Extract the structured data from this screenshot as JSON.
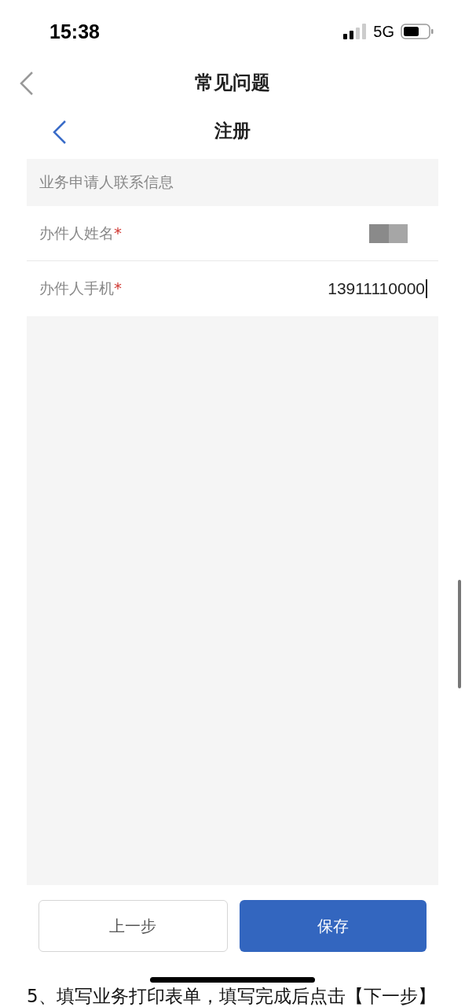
{
  "status_bar": {
    "time": "15:38",
    "network": "5G"
  },
  "nav_bar": {
    "title": "常见问题"
  },
  "sub_header": {
    "title": "注册"
  },
  "form": {
    "section_title": "业务申请人联系信息",
    "fields": [
      {
        "label": "办件人姓名",
        "required_mark": "*",
        "kind": "redacted"
      },
      {
        "label": "办件人手机",
        "required_mark": "*",
        "kind": "text",
        "value": "13911110000",
        "focused": true
      }
    ]
  },
  "buttons": [
    {
      "label": "上一步",
      "kind": "secondary"
    },
    {
      "label": "保存",
      "kind": "primary"
    }
  ],
  "footer_text": "5、填写业务打印表单，填写完成后点击【下一步】"
}
